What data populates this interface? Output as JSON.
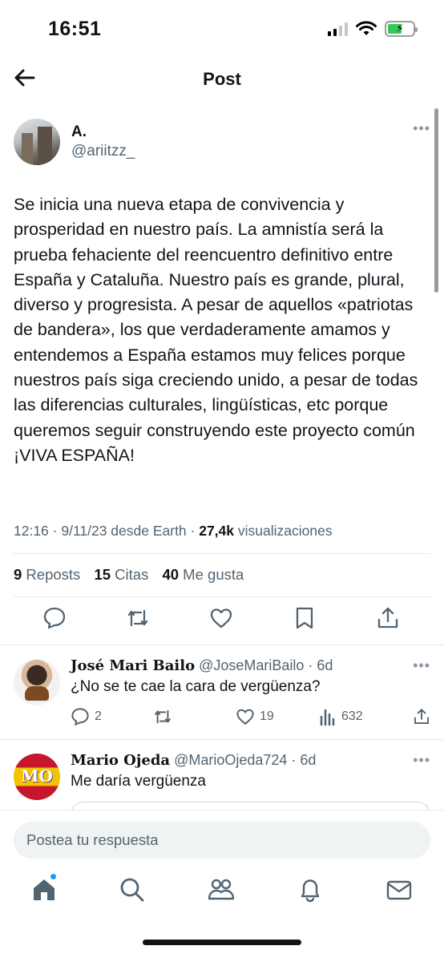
{
  "status_bar": {
    "time": "16:51"
  },
  "nav": {
    "title": "Post"
  },
  "post": {
    "author_name": "A.",
    "author_handle": "@ariitzz_",
    "text": "Se inicia una nueva etapa de convivencia y prosperidad en nuestro país. La amnistía será la prueba fehaciente del reencuentro definitivo entre España y Cataluña. Nuestro país es grande, plural, diverso y progresista. A pesar de aquellos «patriotas de bandera», los que verdaderamente amamos y entendemos a España estamos muy felices porque nuestros país siga creciendo unido, a pesar de todas las diferencias culturales, lingüísticas, etc porque queremos seguir construyendo este proyecto común ¡VIVA ESPAÑA!",
    "timestamp": "12:16 · 9/11/23 desde Earth · ",
    "views_count": "27,4k",
    "views_label": " visualizaciones",
    "reposts_count": "9",
    "reposts_label": " Reposts",
    "quotes_count": "15",
    "quotes_label": " Citas",
    "likes_count": "40",
    "likes_label": " Me gusta"
  },
  "replies": [
    {
      "name": "José Mari Bailo",
      "handle": " @JoseMariBailo · 6d",
      "text": "¿No se te cae la cara de vergüenza?",
      "reply_count": "2",
      "repost_count": "",
      "like_count": "19",
      "view_count": "632"
    },
    {
      "name": "Mario Ojeda",
      "handle": " @MarioOjeda724 · 6d",
      "text": "Me daría vergüenza",
      "avatar_initials": "MO"
    }
  ],
  "composer": {
    "placeholder": "Postea tu respuesta"
  },
  "icons": {
    "back": "arrow-left-icon",
    "more": "more-horizontal-icon",
    "reply": "speech-bubble-icon",
    "repost": "repost-arrows-icon",
    "like": "heart-icon",
    "bookmark": "bookmark-icon",
    "share": "share-upload-icon",
    "views": "bar-chart-icon",
    "tabs": [
      "home-icon",
      "search-icon",
      "communities-icon",
      "bell-icon",
      "mail-icon"
    ]
  },
  "colors": {
    "accent": "#1d9bf0",
    "muted": "#536471",
    "text": "#0f1419",
    "battery": "#34c759"
  }
}
